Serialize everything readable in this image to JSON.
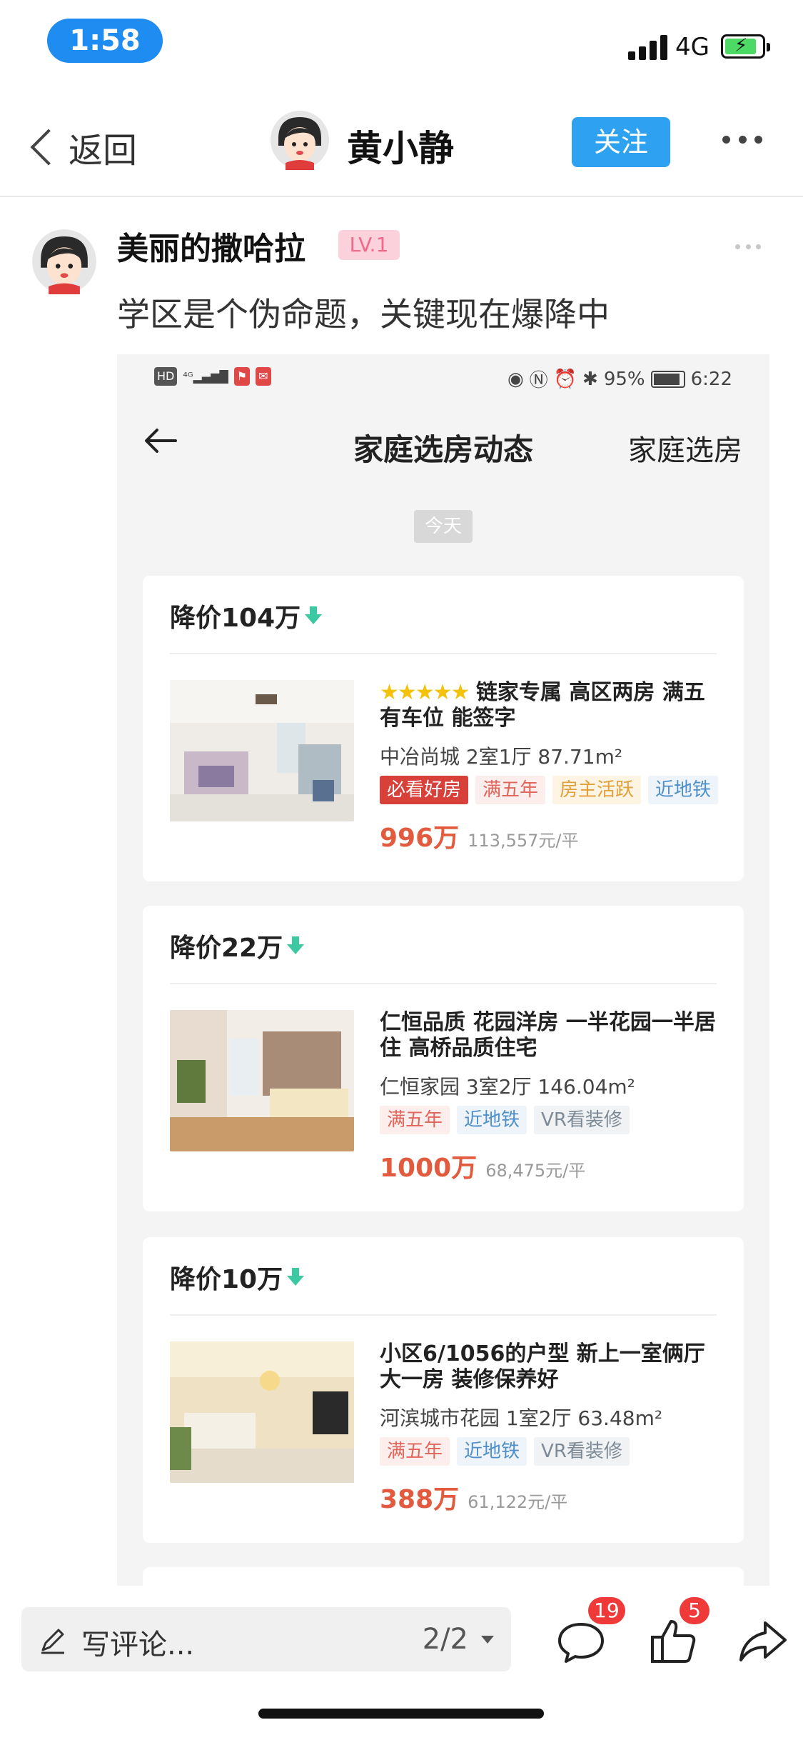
{
  "status_bar": {
    "time": "1:58",
    "network": "4G"
  },
  "nav": {
    "back_label": "返回",
    "author_name": "黄小静",
    "follow_label": "关注"
  },
  "post": {
    "poster_name": "美丽的撒哈拉",
    "level": "LV.1",
    "text": "学区是个伪命题，关键现在爆降中"
  },
  "screenshot": {
    "status": {
      "battery": "95%",
      "time": "6:22"
    },
    "title": "家庭选房动态",
    "right_link": "家庭选房",
    "date_chip": "今天",
    "listings": [
      {
        "drop": "降价104万",
        "stars": "★★★★★",
        "title": "链家专属 高区两房 满五 有车位 能签字",
        "sub": "中冶尚城 2室1厅 87.71m²",
        "tags": [
          {
            "label": "必看好房",
            "kind": "must"
          },
          {
            "label": "满五年",
            "kind": "five"
          },
          {
            "label": "房主活跃",
            "kind": "owner"
          },
          {
            "label": "近地铁",
            "kind": "metro"
          }
        ],
        "price": "996万",
        "unit_price": "113,557元/平"
      },
      {
        "drop": "降价22万",
        "title": "仁恒品质 花园洋房 一半花园一半居住 高桥品质住宅",
        "sub": "仁恒家园 3室2厅 146.04m²",
        "tags": [
          {
            "label": "满五年",
            "kind": "five"
          },
          {
            "label": "近地铁",
            "kind": "metro"
          },
          {
            "label": "VR看装修",
            "kind": "vr"
          }
        ],
        "price": "1000万",
        "unit_price": "68,475元/平"
      },
      {
        "drop": "降价10万",
        "title": "小区6/1056的户型 新上一室俩厅大一房 装修保养好",
        "sub": "河滨城市花园 1室2厅 63.48m²",
        "tags": [
          {
            "label": "满五年",
            "kind": "five"
          },
          {
            "label": "近地铁",
            "kind": "metro"
          },
          {
            "label": "VR看装修",
            "kind": "vr"
          }
        ],
        "price": "388万",
        "unit_price": "61,122元/平"
      }
    ]
  },
  "bottom_bar": {
    "comment_placeholder": "写评论...",
    "page_indicator": "2/2",
    "comment_count": "19",
    "like_count": "5"
  },
  "colors": {
    "accent_blue": "#2ea2f0",
    "price_red": "#e25b3f",
    "drop_green": "#3cc8a0",
    "badge_red": "#f03a3a"
  },
  "icons": [
    "back-chevron-icon",
    "more-icon",
    "pencil-icon",
    "dropdown-caret-icon",
    "comment-icon",
    "thumbs-up-icon",
    "share-icon",
    "down-arrow-icon",
    "battery-icon",
    "signal-icon"
  ]
}
